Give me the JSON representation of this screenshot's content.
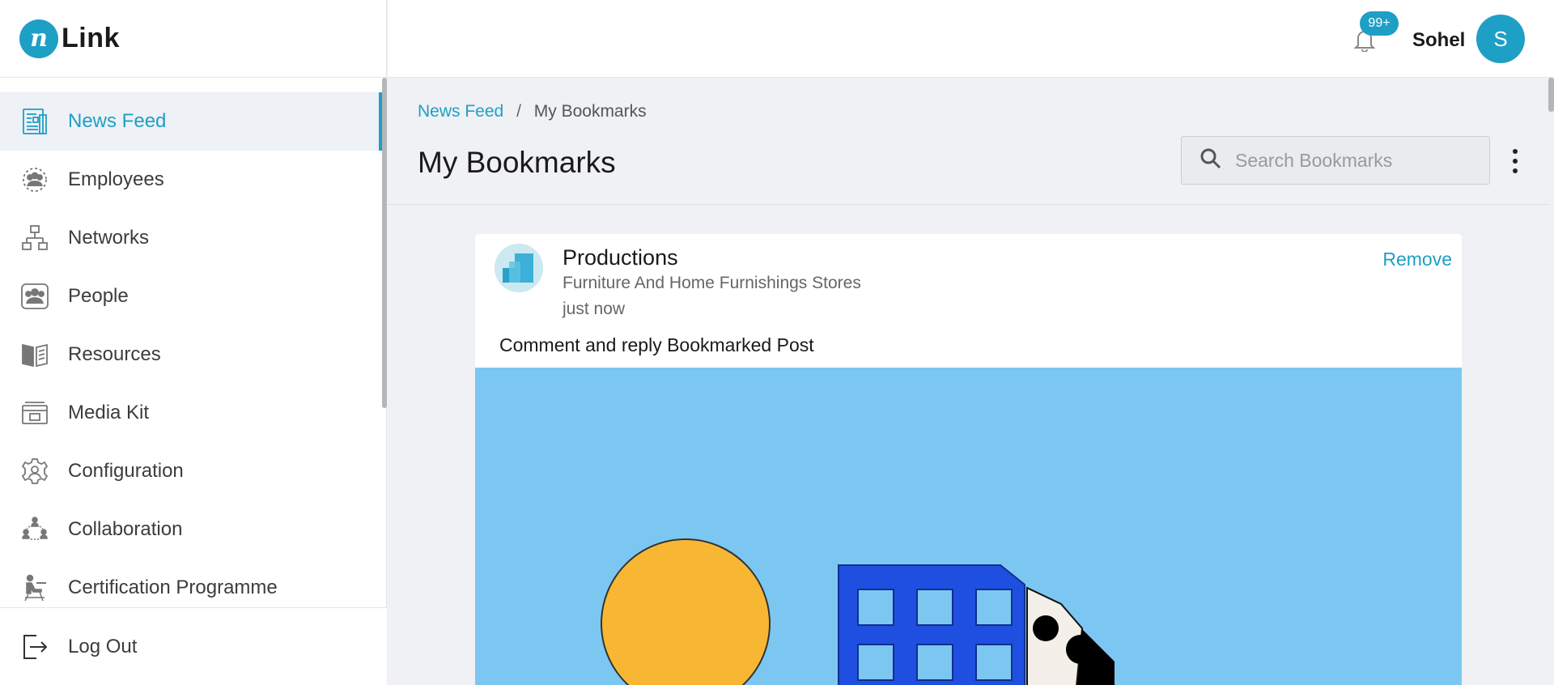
{
  "app": {
    "logo_letter": "n",
    "logo_text": "Link"
  },
  "sidebar": {
    "items": [
      {
        "label": "News Feed",
        "icon": "newspaper-icon",
        "active": true
      },
      {
        "label": "Employees",
        "icon": "employees-icon"
      },
      {
        "label": "Networks",
        "icon": "network-icon"
      },
      {
        "label": "People",
        "icon": "people-icon"
      },
      {
        "label": "Resources",
        "icon": "book-icon"
      },
      {
        "label": "Media Kit",
        "icon": "media-kit-icon"
      },
      {
        "label": "Configuration",
        "icon": "gear-icon"
      },
      {
        "label": "Collaboration",
        "icon": "collaboration-icon"
      },
      {
        "label": "Certification Programme",
        "icon": "certification-icon"
      }
    ],
    "logout_label": "Log Out"
  },
  "header": {
    "notification_badge": "99+",
    "user_name": "Sohel",
    "avatar_initial": "S"
  },
  "breadcrumb": {
    "root": "News Feed",
    "separator": "/",
    "current": "My Bookmarks"
  },
  "page": {
    "title": "My Bookmarks",
    "search_placeholder": "Search Bookmarks"
  },
  "bookmarks": [
    {
      "org_name": "Productions",
      "org_category": "Furniture And Home Furnishings Stores",
      "time": "just now",
      "remove_label": "Remove",
      "text": "Comment and reply Bookmarked Post"
    }
  ],
  "colors": {
    "accent": "#1e9fc6",
    "page_bg": "#f0f1f4",
    "post_image_bg": "#7cc7f1"
  }
}
